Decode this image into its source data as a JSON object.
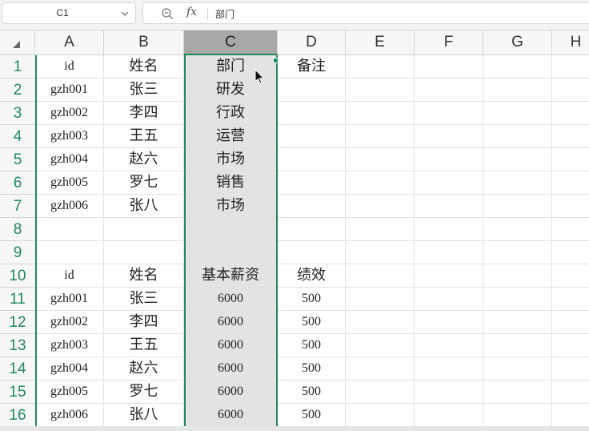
{
  "name_box": {
    "value": "C1"
  },
  "formula_bar": {
    "fx_label": "fx",
    "content": "部门"
  },
  "columns": [
    {
      "key": "A",
      "label": "A",
      "selected": false
    },
    {
      "key": "B",
      "label": "B",
      "selected": false
    },
    {
      "key": "C",
      "label": "C",
      "selected": true
    },
    {
      "key": "D",
      "label": "D",
      "selected": false
    },
    {
      "key": "E",
      "label": "E",
      "selected": false
    },
    {
      "key": "F",
      "label": "F",
      "selected": false
    },
    {
      "key": "G",
      "label": "G",
      "selected": false
    },
    {
      "key": "H",
      "label": "H",
      "selected": false
    }
  ],
  "rows": [
    {
      "num": "1",
      "cells": [
        "id",
        "姓名",
        "部门",
        "备注"
      ]
    },
    {
      "num": "2",
      "cells": [
        "gzh001",
        "张三",
        "研发",
        ""
      ]
    },
    {
      "num": "3",
      "cells": [
        "gzh002",
        "李四",
        "行政",
        ""
      ]
    },
    {
      "num": "4",
      "cells": [
        "gzh003",
        "王五",
        "运营",
        ""
      ]
    },
    {
      "num": "5",
      "cells": [
        "gzh004",
        "赵六",
        "市场",
        ""
      ]
    },
    {
      "num": "6",
      "cells": [
        "gzh005",
        "罗七",
        "销售",
        ""
      ]
    },
    {
      "num": "7",
      "cells": [
        "gzh006",
        "张八",
        "市场",
        ""
      ]
    },
    {
      "num": "8",
      "cells": [
        "",
        "",
        "",
        ""
      ]
    },
    {
      "num": "9",
      "cells": [
        "",
        "",
        "",
        ""
      ]
    },
    {
      "num": "10",
      "cells": [
        "id",
        "姓名",
        "基本薪资",
        "绩效"
      ]
    },
    {
      "num": "11",
      "cells": [
        "gzh001",
        "张三",
        "6000",
        "500"
      ]
    },
    {
      "num": "12",
      "cells": [
        "gzh002",
        "李四",
        "6000",
        "500"
      ]
    },
    {
      "num": "13",
      "cells": [
        "gzh003",
        "王五",
        "6000",
        "500"
      ]
    },
    {
      "num": "14",
      "cells": [
        "gzh004",
        "赵六",
        "6000",
        "500"
      ]
    },
    {
      "num": "15",
      "cells": [
        "gzh005",
        "罗七",
        "6000",
        "500"
      ]
    },
    {
      "num": "16",
      "cells": [
        "gzh006",
        "张八",
        "6000",
        "500"
      ]
    }
  ],
  "colors": {
    "accent": "#1e8a5a",
    "selected_header": "#a8a8a8",
    "selected_column": "#e3e3e3"
  }
}
